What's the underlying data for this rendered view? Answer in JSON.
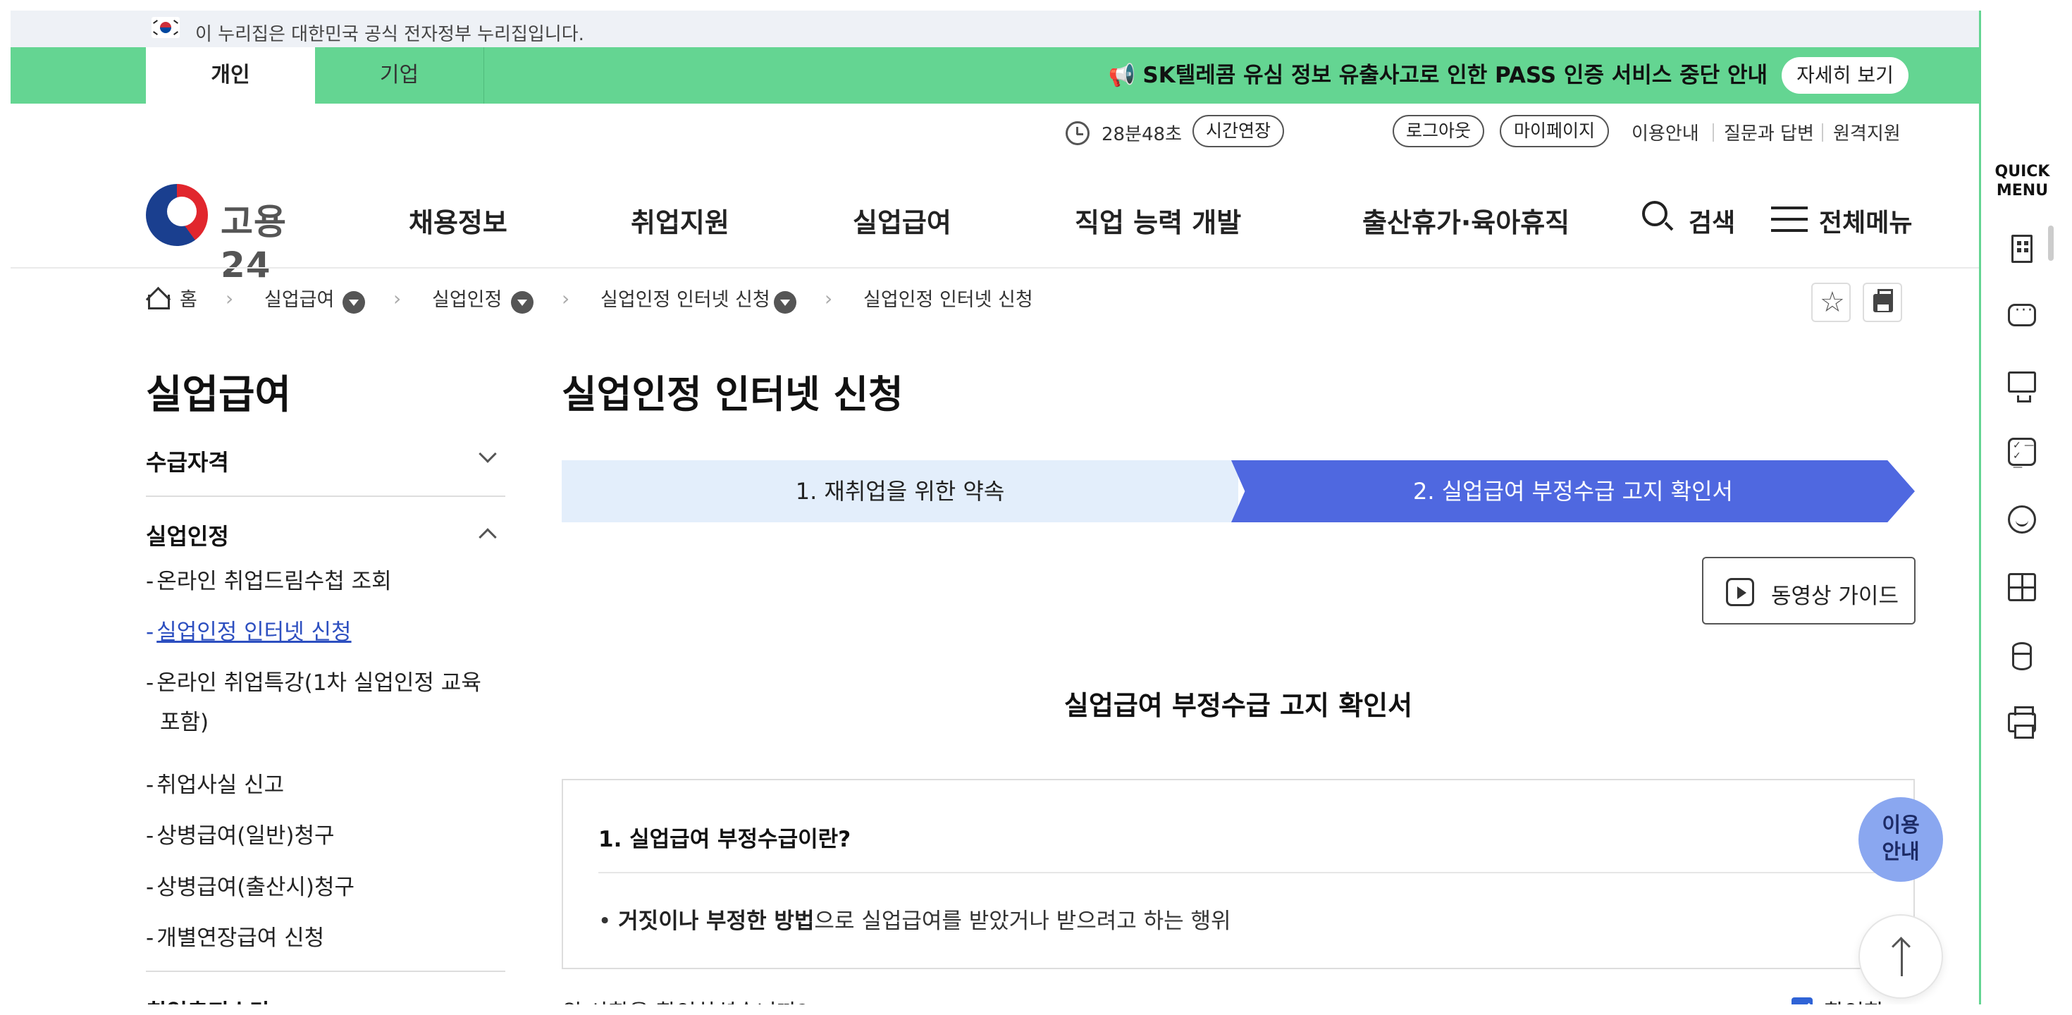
{
  "gov_banner": {
    "text": "이 누리집은 대한민국 공식 전자정부 누리집입니다."
  },
  "top_tabs": {
    "person": "개인",
    "company": "기업"
  },
  "notice": {
    "icon": "megaphone-icon",
    "text": "SK텔레콤 유심 정보 유출사고로 인한 PASS 인증 서비스 중단 안내",
    "button": "자세히 보기"
  },
  "utility": {
    "timer": "28분48초",
    "extend": "시간연장",
    "logout": "로그아웃",
    "mypage": "마이페이지",
    "links": [
      "이용안내",
      "질문과 답변",
      "원격지원"
    ]
  },
  "logo": {
    "text": "고용24"
  },
  "nav": {
    "items": [
      "채용정보",
      "취업지원",
      "실업급여",
      "직업 능력 개발",
      "출산휴가·육아휴직"
    ],
    "search": "검색",
    "all_menu": "전체메뉴"
  },
  "breadcrumb": [
    "홈",
    "실업급여",
    "실업인정",
    "실업인정 인터넷 신청",
    "실업인정 인터넷 신청"
  ],
  "sidebar": {
    "title": "실업급여",
    "sections": [
      {
        "label": "수급자격"
      },
      {
        "label": "실업인정"
      }
    ],
    "items": [
      {
        "label": "온라인 취업드림수첩 조회"
      },
      {
        "label": "실업인정 인터넷 신청"
      },
      {
        "label": "온라인 취업특강(1차 실업인정 교육"
      },
      {
        "label": "포함)"
      },
      {
        "label": "취업사실 신고"
      },
      {
        "label": "상병급여(일반)청구"
      },
      {
        "label": "상병급여(출산시)청구"
      },
      {
        "label": "개별연장급여 신청"
      }
    ],
    "dash": "-",
    "cut_section": "취업촉진수당"
  },
  "main": {
    "title": "실업인정 인터넷 신청",
    "steps": [
      "1. 재취업을 위한 약속",
      "2. 실업급여 부정수급 고지 확인서"
    ],
    "active_step": 2,
    "video_guide": "동영상 가이드",
    "doc_title": "실업급여 부정수급 고지 확인서",
    "question": "1. 실업급여 부정수급이란?",
    "bullet_bold": "거짓이나 부정한 방법",
    "bullet_rest": "으로 실업급여를 받았거나 받으려고 하는 행위",
    "bullet_mark": "•",
    "confirm_question": "위 사항을 확인하셨습니까?",
    "confirm_label": "확인함",
    "confirm_checked": true
  },
  "floating": {
    "guide": [
      "이용",
      "안내"
    ]
  },
  "quick_menu": {
    "title": [
      "QUICK",
      "MENU"
    ],
    "icons": [
      "building-icon",
      "chat-icon",
      "monitor-icon",
      "checklist-icon",
      "smile-icon",
      "calculator-icon",
      "coin-icon",
      "printer-icon"
    ]
  },
  "colors": {
    "green": "#64d592",
    "step_active": "#4f68e0",
    "step_inactive": "#e3eefb",
    "guide_bubble": "#8aa7f0"
  }
}
